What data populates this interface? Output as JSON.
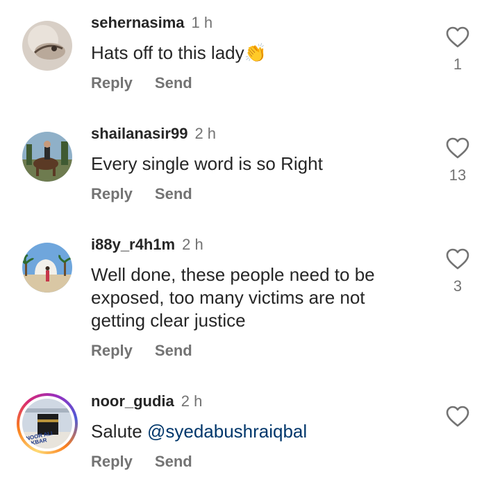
{
  "comments": [
    {
      "username": "sehernasima",
      "time": "1 h",
      "text": "Hats off to this lady",
      "emoji": "👏",
      "like_count": "1",
      "reply_label": "Reply",
      "send_label": "Send",
      "avatar": "hands-photo"
    },
    {
      "username": "shailanasir99",
      "time": "2 h",
      "text": "Every single word is so Right",
      "like_count": "13",
      "reply_label": "Reply",
      "send_label": "Send",
      "avatar": "horse-rider-photo"
    },
    {
      "username": "i88y_r4h1m",
      "time": "2 h",
      "text_lines": [
        "Well done, these people need to be",
        "exposed, too many victims are not",
        "getting clear justice"
      ],
      "like_count": "3",
      "reply_label": "Reply",
      "send_label": "Send",
      "avatar": "palm-tree-photo"
    },
    {
      "username": "noor_gudia",
      "time": "2 h",
      "text_prefix": "Salute",
      "mention": "@syedabushraiqbal",
      "like_count": "",
      "reply_label": "Reply",
      "send_label": "Send",
      "avatar": "kaaba-photo",
      "avatar_caption": "NOOR ALI AKBAR",
      "has_story_ring": true
    }
  ],
  "colors": {
    "username": "#262626",
    "secondary": "#737373",
    "mention": "#00376b"
  }
}
